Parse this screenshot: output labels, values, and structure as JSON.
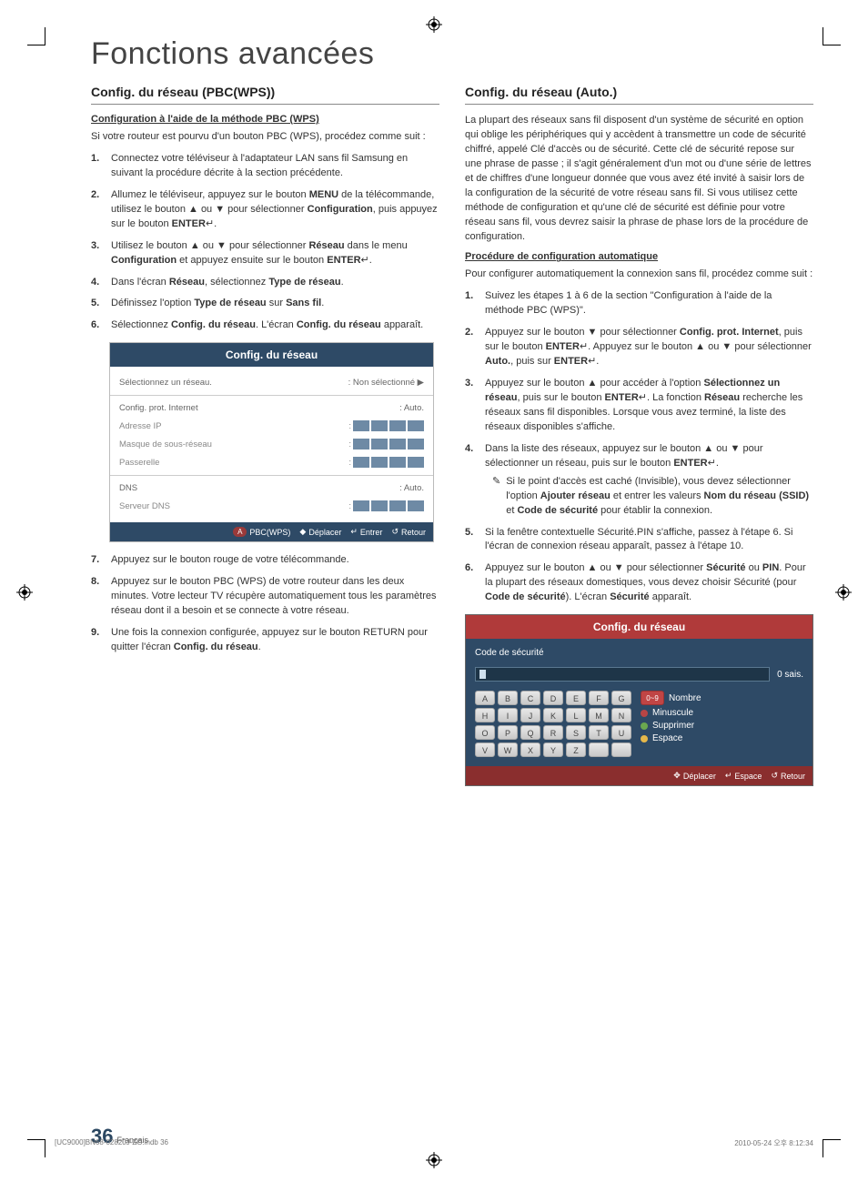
{
  "header": {
    "title": "Fonctions avancées"
  },
  "left": {
    "h2": "Config. du réseau (PBC(WPS))",
    "h3": "Configuration à l'aide de la méthode PBC (WPS)",
    "intro": "Si votre routeur est pourvu d'un bouton PBC (WPS), procédez comme suit :",
    "steps1": {
      "s1": "Connectez votre téléviseur à l'adaptateur LAN sans fil Samsung en suivant la procédure décrite à la section précédente.",
      "s2a": "Allumez le téléviseur, appuyez sur le bouton ",
      "s2_menu": "MENU",
      "s2b": " de la télécommande, utilisez le bouton ▲ ou ▼ pour sélectionner ",
      "s2_config": "Configuration",
      "s2c": ", puis appuyez sur le bouton ",
      "s2_enter": "ENTER",
      "s2d": ".",
      "s3a": "Utilisez le bouton ▲ ou ▼ pour sélectionner ",
      "s3_reseau": "Réseau",
      "s3b": " dans le menu ",
      "s3_config": "Configuration",
      "s3c": " et appuyez ensuite sur le bouton ",
      "s3_enter": "ENTER",
      "s3d": ".",
      "s4a": "Dans l'écran ",
      "s4_reseau": "Réseau",
      "s4b": ", sélectionnez ",
      "s4_type": "Type de réseau",
      "s4c": ".",
      "s5a": "Définissez l'option ",
      "s5_type": "Type de réseau",
      "s5b": " sur ",
      "s5_sans": "Sans fil",
      "s5c": ".",
      "s6a": "Sélectionnez ",
      "s6_cfg": "Config. du réseau",
      "s6b": ". L'écran ",
      "s6_cfg2": "Config. du réseau",
      "s6c": " apparaît."
    },
    "panel": {
      "title": "Config. du réseau",
      "rows": {
        "select_net": "Sélectionnez un réseau.",
        "select_val": ": Non sélectionné  ▶",
        "cfg_prot": "Config. prot. Internet",
        "cfg_prot_val": ": Auto.",
        "ip": "Adresse IP",
        "mask": "Masque de sous-réseau",
        "gateway": "Passerelle",
        "dns": "DNS",
        "dns_val": ": Auto.",
        "dns_srv": "Serveur DNS"
      },
      "footer": {
        "pbc": "PBC(WPS)",
        "move": "Déplacer",
        "enter": "Entrer",
        "return": "Retour",
        "a_label": "A"
      }
    },
    "steps2": {
      "s7": "Appuyez sur le bouton rouge de votre télécommande.",
      "s8": "Appuyez sur le bouton PBC (WPS) de votre routeur dans les deux minutes. Votre lecteur TV récupère automatiquement tous les paramètres réseau dont il a besoin et se connecte à votre réseau.",
      "s9a": "Une fois la connexion configurée, appuyez sur le bouton RETURN pour quitter l'écran ",
      "s9_cfg": "Config. du réseau",
      "s9b": "."
    }
  },
  "right": {
    "h2": "Config. du réseau (Auto.)",
    "intro": "La plupart des réseaux sans fil disposent d'un système de sécurité en option qui oblige les périphériques qui y accèdent à transmettre un code de sécurité chiffré, appelé Clé d'accès ou de sécurité. Cette clé de sécurité repose sur une phrase de passe ; il s'agit généralement d'un mot ou d'une série de lettres et de chiffres d'une longueur donnée que vous avez été invité à saisir lors de la configuration de la sécurité de votre réseau sans fil.  Si vous utilisez cette méthode de configuration et qu'une clé de sécurité est définie pour votre réseau sans fil, vous devrez saisir la phrase de phase lors de la procédure de configuration.",
    "h3": "Procédure de configuration automatique",
    "intro2": "Pour configurer automatiquement la connexion sans fil, procédez comme suit :",
    "steps": {
      "s1": "Suivez les étapes 1 à 6 de la section \"Configuration à l'aide de la méthode PBC (WPS)\".",
      "s2a": "Appuyez sur le bouton ▼ pour sélectionner ",
      "s2_cfg": "Config. prot. Internet",
      "s2b": ", puis sur le bouton ",
      "s2_enter": "ENTER",
      "s2c": ". Appuyez sur le bouton ▲ ou ▼ pour sélectionner ",
      "s2_auto": "Auto.",
      "s2d": ", puis sur ",
      "s2_enter2": "ENTER",
      "s2e": ".",
      "s3a": "Appuyez sur le bouton ▲ pour accéder à l'option ",
      "s3_sel": "Sélectionnez un réseau",
      "s3b": ", puis sur le bouton ",
      "s3_enter": "ENTER",
      "s3c": ". La fonction ",
      "s3_reseau": "Réseau",
      "s3d": " recherche les réseaux sans fil disponibles. Lorsque vous avez terminé, la liste des réseaux disponibles s'affiche.",
      "s4a": "Dans la liste des réseaux, appuyez sur le bouton ▲ ou ▼ pour sélectionner un réseau, puis sur le bouton ",
      "s4_enter": "ENTER",
      "s4b": ".",
      "note_icon": "✎",
      "note_a": "Si le point d'accès est caché (Invisible), vous devez sélectionner l'option ",
      "note_add": "Ajouter réseau",
      "note_b": " et entrer les valeurs ",
      "note_ssid": "Nom du réseau (SSID)",
      "note_and": " et ",
      "note_code": "Code de sécurité",
      "note_c": " pour établir la connexion.",
      "s5": "Si la fenêtre contextuelle Sécurité.PIN s'affiche, passez à l'étape 6. Si l'écran de connexion réseau apparaît, passez à l'étape 10.",
      "s6a": "Appuyez sur le bouton ▲ ou ▼ pour sélectionner ",
      "s6_sec": "Sécurité",
      "s6b": " ou ",
      "s6_pin": "PIN",
      "s6c": ". Pour la plupart des réseaux domestiques, vous devez choisir Sécurité (pour ",
      "s6_code": "Code de sécurité",
      "s6d": "). L'écran ",
      "s6_sec2": "Sécurité",
      "s6e": " apparaît."
    },
    "kbd": {
      "title": "Config. du réseau",
      "label": "Code de sécurité",
      "count": "0 sais.",
      "side": {
        "num": "0~9",
        "num_label": "Nombre",
        "min_label": "Minuscule",
        "del_label": "Supprimer",
        "space_label": "Espace"
      },
      "footer": {
        "move": "Déplacer",
        "space": "Espace",
        "return": "Retour"
      },
      "keys": [
        "A",
        "B",
        "C",
        "D",
        "E",
        "F",
        "G",
        "H",
        "I",
        "J",
        "K",
        "L",
        "M",
        "N",
        "O",
        "P",
        "Q",
        "R",
        "S",
        "T",
        "U",
        "V",
        "W",
        "X",
        "Y",
        "Z",
        "",
        ""
      ]
    }
  },
  "page": {
    "num": "36",
    "lang": "Français"
  },
  "docfooter": {
    "left": "[UC9000]BN68-02820J-ZG.indb   36",
    "right": "2010-05-24   오후 8:12:34"
  },
  "icons": {
    "enter": "↵",
    "updown": "◆",
    "return": "↺",
    "move4": "✥"
  }
}
